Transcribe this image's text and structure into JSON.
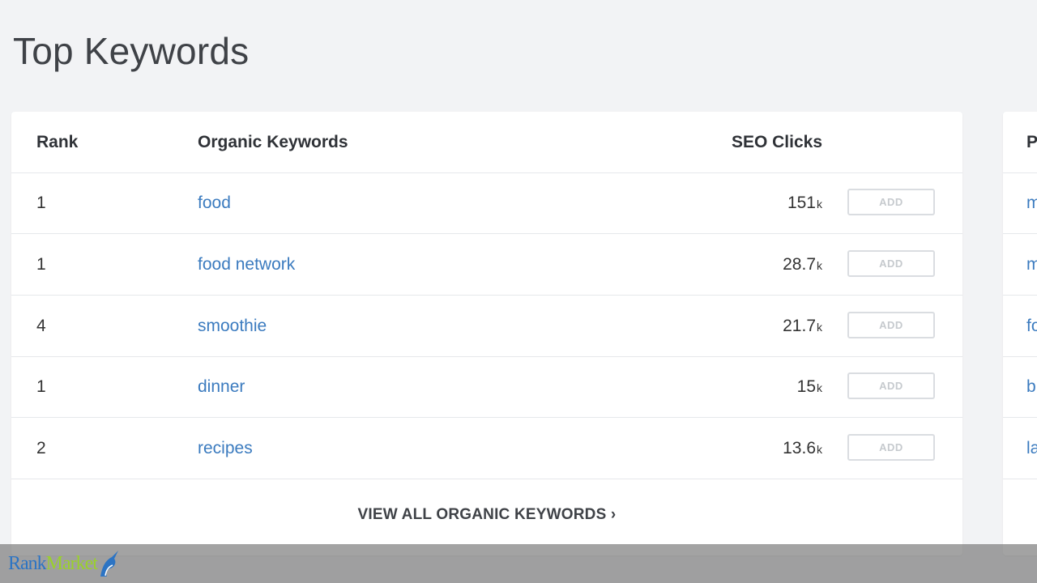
{
  "page": {
    "title": "Top Keywords"
  },
  "table": {
    "headers": {
      "rank": "Rank",
      "keyword": "Organic Keywords",
      "clicks": "SEO Clicks"
    },
    "add_label": "ADD",
    "rows": [
      {
        "rank": "1",
        "keyword": "food",
        "clicks": "151",
        "unit": "k"
      },
      {
        "rank": "1",
        "keyword": "food network",
        "clicks": "28.7",
        "unit": "k"
      },
      {
        "rank": "4",
        "keyword": "smoothie",
        "clicks": "21.7",
        "unit": "k"
      },
      {
        "rank": "1",
        "keyword": "dinner",
        "clicks": "15",
        "unit": "k"
      },
      {
        "rank": "2",
        "keyword": "recipes",
        "clicks": "13.6",
        "unit": "k"
      }
    ],
    "view_all": "VIEW ALL ORGANIC KEYWORDS ›"
  },
  "side_card": {
    "header": "P",
    "items": [
      "m",
      "m",
      "fo",
      "b",
      "la"
    ]
  },
  "watermark": {
    "brand_part1": "Rank",
    "brand_part2": "Market"
  },
  "colors": {
    "link": "#3b7bbf",
    "background": "#f2f3f5",
    "logo_blue": "#2c74c4",
    "logo_green": "#9ad12b"
  }
}
